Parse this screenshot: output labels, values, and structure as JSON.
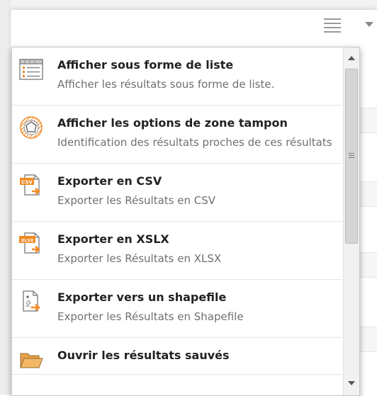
{
  "toolbar": {
    "menu_icon": "hamburger-list-icon",
    "dropdown_icon": "chevron-down-icon"
  },
  "menu": {
    "items": [
      {
        "title": "Afficher sous forme de liste",
        "description": "Afficher les résultats sous forme de liste.",
        "icon": "list-view-icon"
      },
      {
        "title": "Afficher les options de zone tampon",
        "description": "Identification des résultats proches de ces résultats",
        "icon": "buffer-zone-icon"
      },
      {
        "title": "Exporter en CSV",
        "description": "Exporter les Résultats en CSV",
        "icon": "export-csv-icon",
        "badge": "CSV"
      },
      {
        "title": "Exporter en XSLX",
        "description": "Exporter les Résultats en XLSX",
        "icon": "export-xlsx-icon",
        "badge": "XLSX"
      },
      {
        "title": "Exporter vers un shapefile",
        "description": "Exporter les Résultats en Shapefile",
        "icon": "export-shapefile-icon"
      },
      {
        "title": "Ouvrir les résultats sauvés",
        "description": "",
        "icon": "folder-open-icon"
      }
    ]
  },
  "colors": {
    "title": "#222222",
    "description": "#707070",
    "export_orange": "#f08a24",
    "icon_gray": "#8a8a8a"
  }
}
